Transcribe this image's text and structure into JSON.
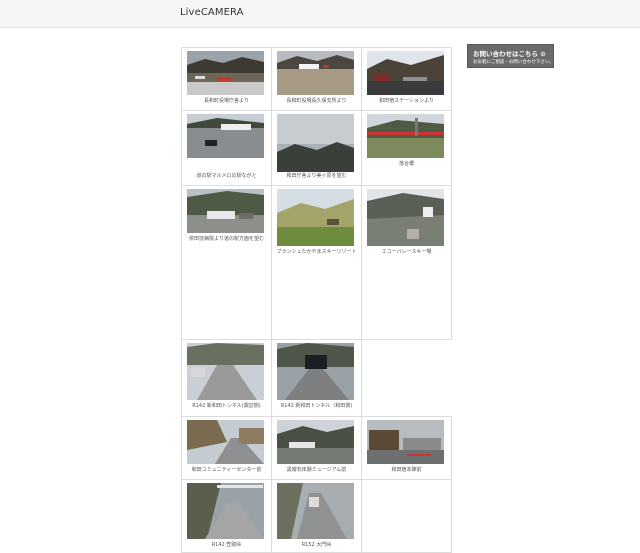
{
  "header": {
    "title": "LiveCAMERA"
  },
  "contact_button": {
    "label": "お問い合わせはこちら ⊙",
    "sublabel": "お気軽にご相談・お問い合わせ下さい。"
  },
  "cameras": [
    {
      "caption": "長和町役場庁舎より"
    },
    {
      "caption": "長和町役場長久保支所より"
    },
    {
      "caption": "和田宿ステーションより"
    },
    {
      "caption": "道の駅マルメロの駅ながと"
    },
    {
      "caption": "和田庁舎より美ヶ原を望む"
    },
    {
      "caption": "落合橋"
    },
    {
      "caption": "依田窪病院より道の駅方面を望む"
    },
    {
      "caption": "ブランシュたかやまスキーリゾート"
    },
    {
      "caption": "エコーバレースキー場"
    },
    {
      "caption": "R142 新和田トンネル(諏訪側)"
    },
    {
      "caption": "R142 新和田トンネル（和田側)"
    },
    {
      "caption": "和田コミュニティーセンター前"
    },
    {
      "caption": "黒曜石体験ミュージアム前"
    },
    {
      "caption": "和田宿本陣前"
    },
    {
      "caption": "R142 笠取峠"
    },
    {
      "caption": "R152 大門峠"
    }
  ]
}
